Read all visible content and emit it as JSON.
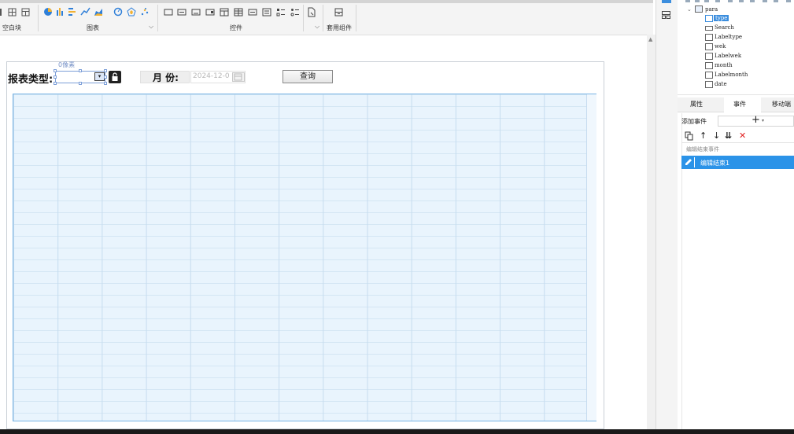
{
  "toolbar": {
    "groups": [
      {
        "label": "空白块"
      },
      {
        "label": "图表"
      },
      {
        "label": "控件"
      },
      {
        "label": "套用组件"
      }
    ],
    "chart_icon_names": [
      "pie-chart-icon",
      "bar-chart-icon",
      "gantt-chart-icon",
      "line-chart-icon",
      "area-chart-icon",
      "gauge-chart-icon",
      "radar-chart-icon",
      "scatter-chart-icon"
    ],
    "control_icon_names": [
      "label-widget-icon",
      "text-widget-icon",
      "button-widget-icon",
      "combo-widget-icon",
      "date-widget-icon",
      "table-widget-icon",
      "number-widget-icon",
      "list-widget-icon",
      "checkbox-group-icon",
      "radio-group-icon"
    ]
  },
  "canvas": {
    "width_hint": "0像素",
    "type_label": "报表类型:",
    "month_label": "月 份:",
    "month_value": "2024-12-0",
    "query_button": "查询"
  },
  "tree": {
    "root": "para",
    "nodes": [
      "type",
      "Search",
      "Labeltype",
      "wek",
      "Labelwek",
      "month",
      "Labelmonth",
      "date"
    ],
    "selected": "type"
  },
  "panel": {
    "tabs": [
      "属性",
      "事件",
      "移动端"
    ],
    "active_tab": "事件",
    "add_event_label": "添加事件",
    "event_section_title": "编辑结束事件",
    "event_item": "编辑结束1"
  },
  "colors": {
    "accent": "#2b93e8",
    "grid_fill": "#e9f4fd",
    "grid_border": "#78b4e4"
  }
}
